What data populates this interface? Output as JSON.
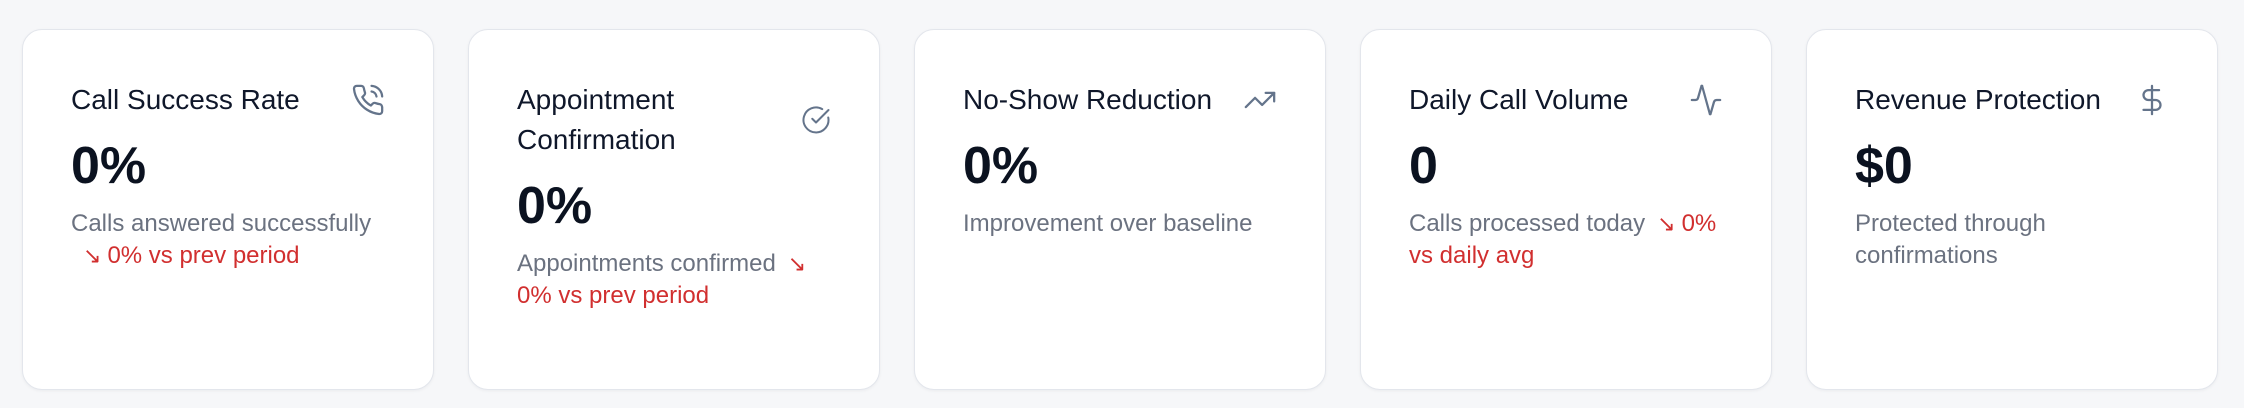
{
  "cards": [
    {
      "title": "Call Success Rate",
      "icon": "phone-call-icon",
      "value": "0%",
      "description": "Calls answered successfully",
      "trend": {
        "arrow": "↘",
        "text": "0% vs prev period"
      }
    },
    {
      "title": "Appointment Confirmation",
      "icon": "check-circle-icon",
      "value": "0%",
      "description": "Appointments confirmed",
      "trend": {
        "arrow": "↘",
        "text": "0% vs prev period"
      }
    },
    {
      "title": "No-Show Reduction",
      "icon": "trending-up-icon",
      "value": "0%",
      "description": "Improvement over baseline"
    },
    {
      "title": "Daily Call Volume",
      "icon": "activity-icon",
      "value": "0",
      "description": "Calls processed today",
      "trend": {
        "arrow": "↘",
        "text": "0% vs daily avg"
      }
    },
    {
      "title": "Revenue Protection",
      "icon": "dollar-sign-icon",
      "value": "$0",
      "description": "Protected through confirmations"
    }
  ],
  "colors": {
    "trend_down": "#d12f2f",
    "icon": "#64748b"
  }
}
